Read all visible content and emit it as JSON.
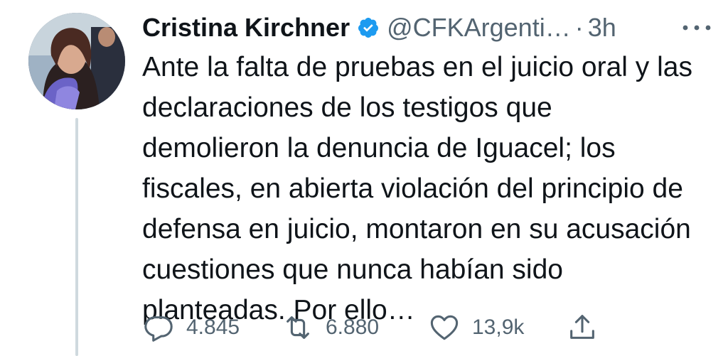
{
  "tweet": {
    "author_name": "Cristina Kirchner",
    "handle": "@CFKArgenti…",
    "separator": "·",
    "time": "3h",
    "text": "Ante la falta de pruebas en el juicio oral y las declaraciones de los testigos que demolieron la denuncia de Iguacel; los fiscales, en abierta violación del principio de defensa en juicio, montaron en su acusación cuestiones que nunca habían sido planteadas. Por ello…",
    "text_lines": [
      "Ante la falta de pruebas en el juicio oral y las",
      "declaraciones de los testigos que",
      "demolieron la denuncia de Iguacel; los",
      "fiscales, en abierta violación del principio de",
      "defensa en juicio, montaron en su acusación",
      "cuestiones que nunca habían sido",
      "planteadas. Por ello…"
    ]
  },
  "actions": {
    "replies": "4.845",
    "retweets": "6.880",
    "likes": "13,9k"
  },
  "icons": {
    "verified": "verified-badge-icon",
    "more": "more-horizontal-icon",
    "reply": "reply-icon",
    "retweet": "retweet-icon",
    "like": "heart-icon",
    "share": "share-icon"
  },
  "colors": {
    "verified_blue": "#1d9bf0",
    "text_primary": "#0f1419",
    "text_secondary": "#536471",
    "thread_line": "#cfd9de"
  }
}
